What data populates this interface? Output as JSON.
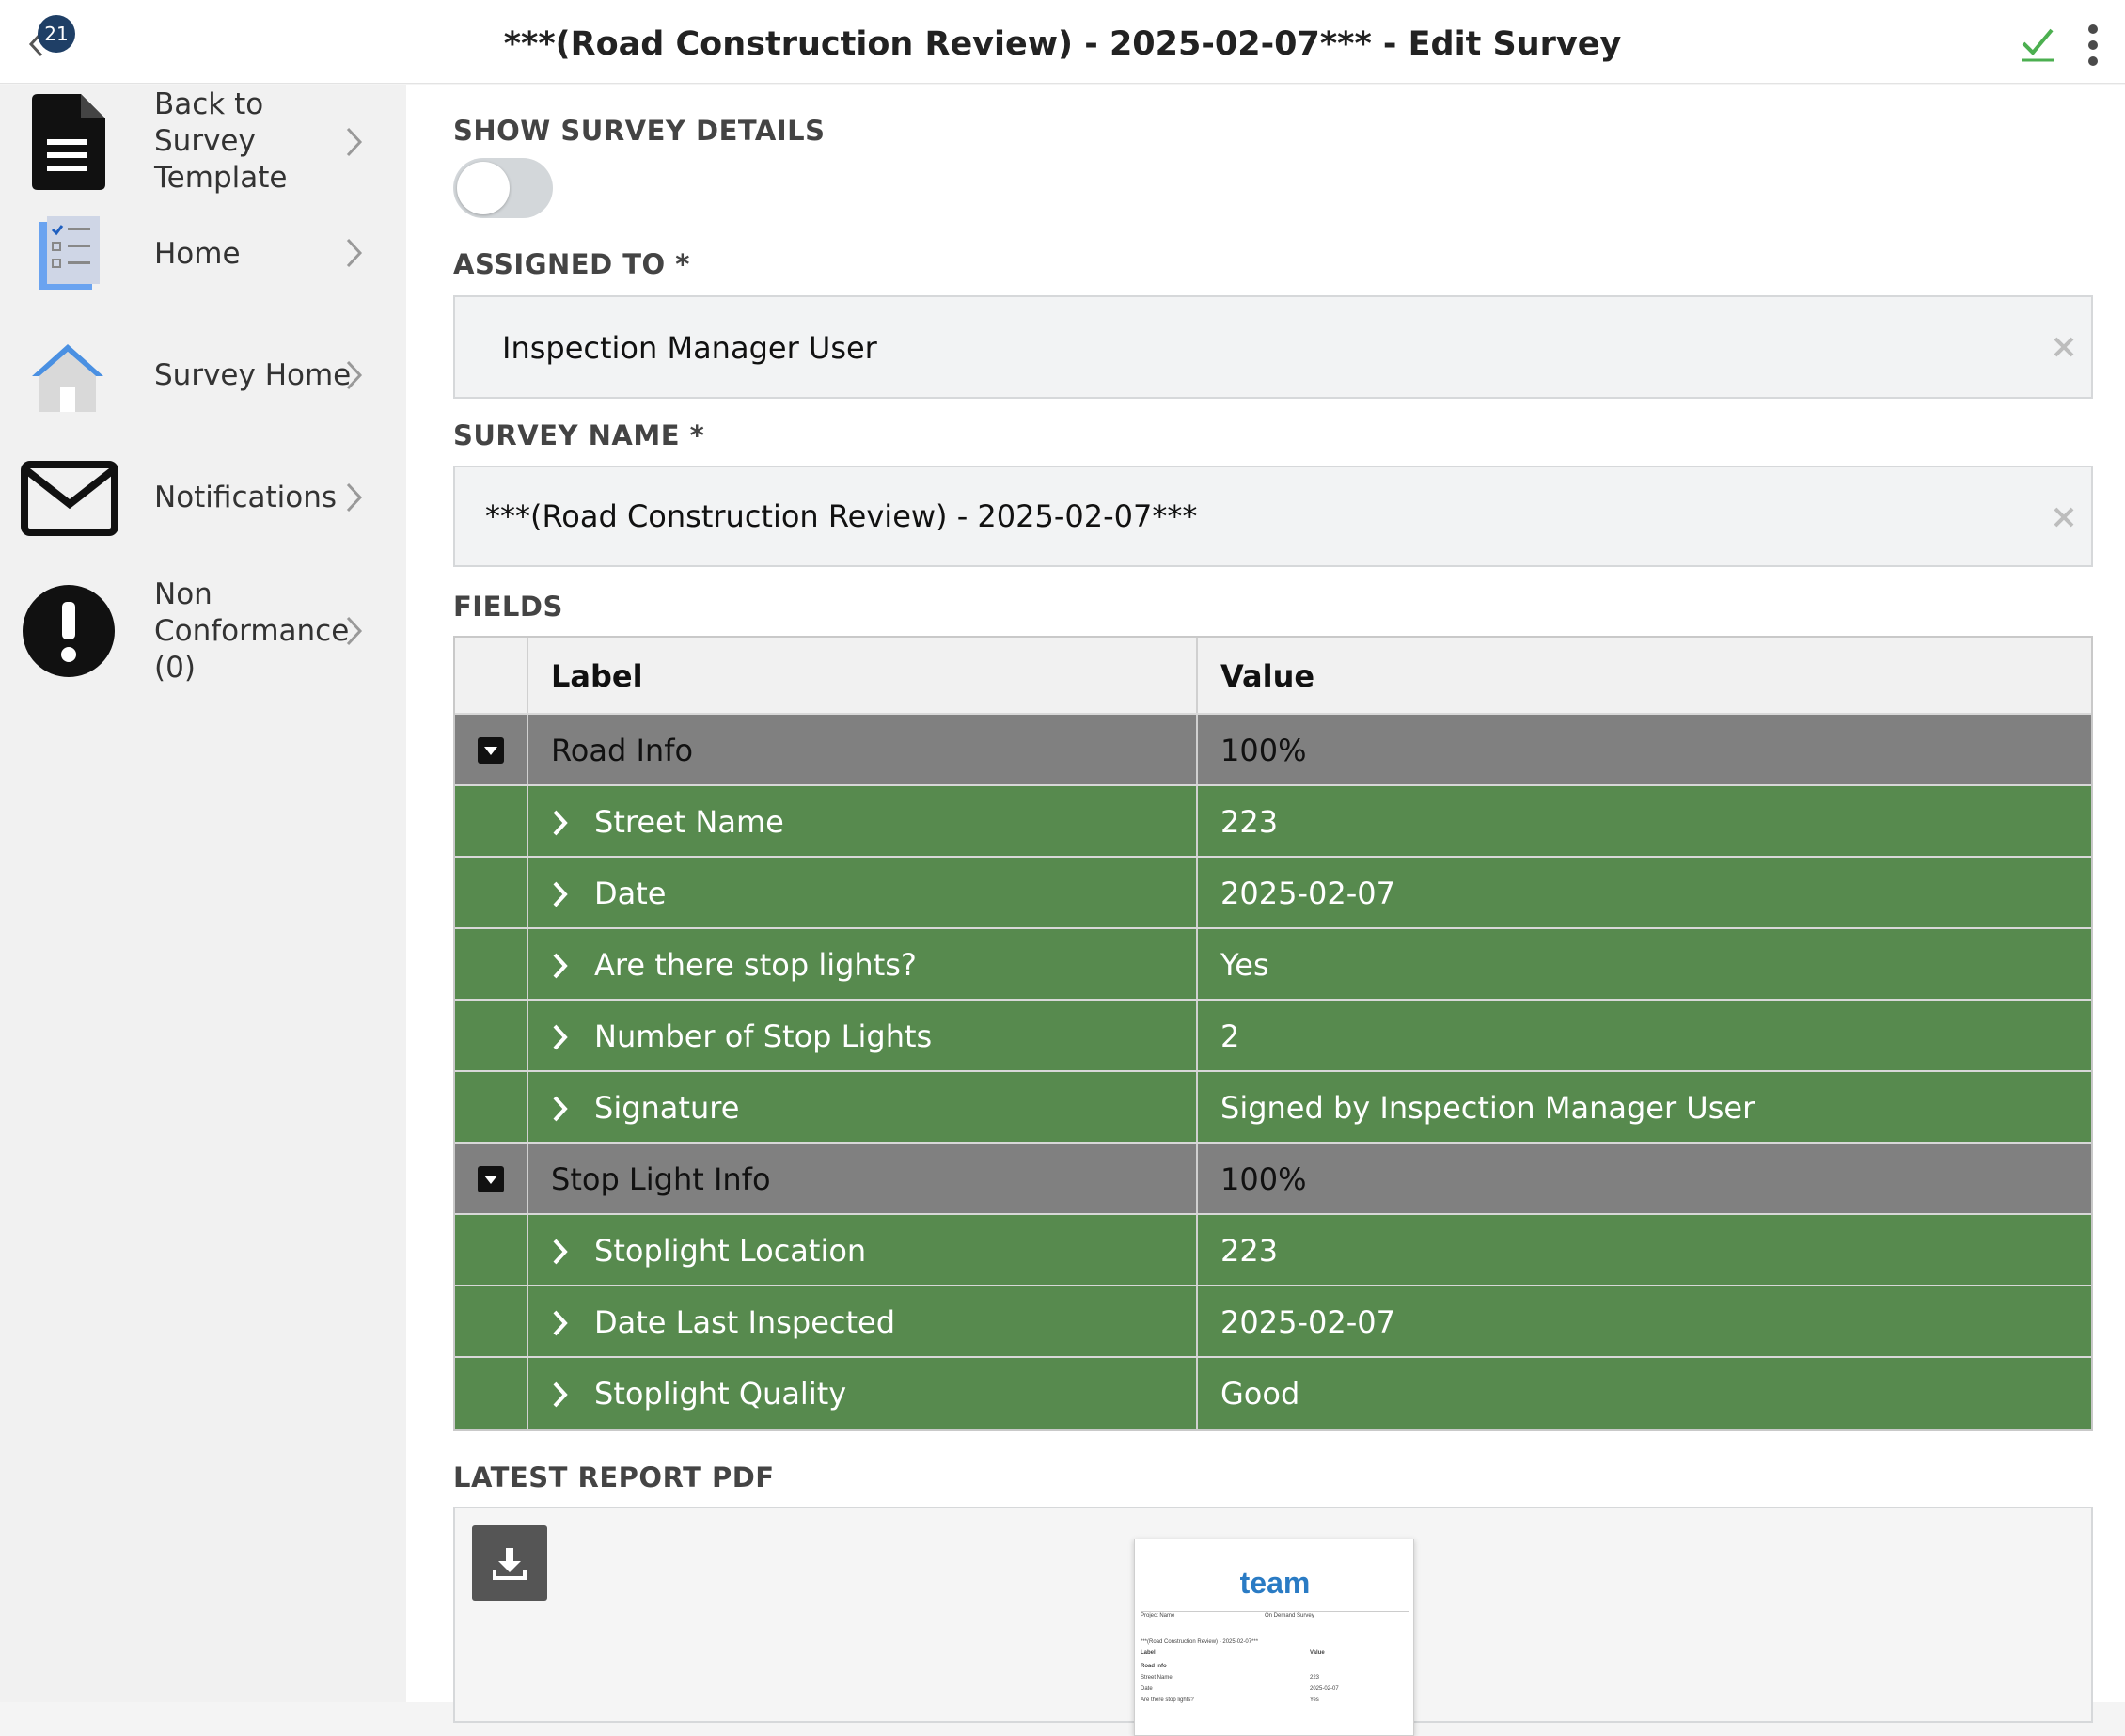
{
  "header": {
    "badge_count": "21",
    "title": "***(Road Construction Review) - 2025-02-07*** - Edit Survey",
    "accent_color": "#4caf50"
  },
  "sidebar": {
    "items": [
      {
        "label_lines": [
          "Back to",
          "Survey",
          "Template"
        ],
        "icon": "document-icon"
      },
      {
        "label_lines": [
          "Home"
        ],
        "icon": "checklist-icon"
      },
      {
        "label_lines": [
          "Survey Home"
        ],
        "icon": "house-icon"
      },
      {
        "label_lines": [
          "Notifications"
        ],
        "icon": "envelope-icon"
      },
      {
        "label_lines": [
          "Non",
          "Conformance",
          "(0)"
        ],
        "icon": "exclamation-icon"
      }
    ]
  },
  "main": {
    "show_details_label": "SHOW SURVEY DETAILS",
    "show_details_on": false,
    "assigned_label": "ASSIGNED TO *",
    "assigned_value": "Inspection Manager User",
    "survey_name_label": "SURVEY NAME *",
    "survey_name_value": "***(Road Construction Review) - 2025-02-07***",
    "fields_label": "FIELDS",
    "table": {
      "col_label": "Label",
      "col_value": "Value",
      "rows": [
        {
          "type": "group",
          "label": "Road Info",
          "value": "100%"
        },
        {
          "type": "item",
          "label": "Street Name",
          "value": "223"
        },
        {
          "type": "item",
          "label": "Date",
          "value": "2025-02-07"
        },
        {
          "type": "item",
          "label": "Are there stop lights?",
          "value": "Yes"
        },
        {
          "type": "item",
          "label": "Number of Stop Lights",
          "value": "2"
        },
        {
          "type": "item",
          "label": "Signature",
          "value": "Signed by Inspection Manager User"
        },
        {
          "type": "group",
          "label": "Stop Light Info",
          "value": "100%"
        },
        {
          "type": "item",
          "label": "Stoplight Location",
          "value": "223"
        },
        {
          "type": "item",
          "label": "Date Last Inspected",
          "value": "2025-02-07"
        },
        {
          "type": "item",
          "label": "Stoplight Quality",
          "value": "Good"
        }
      ]
    },
    "pdf_label": "LATEST REPORT PDF",
    "pdf_thumb": {
      "logo": "team",
      "lines": [
        "Project Name",
        "On Demand Survey",
        "***(Road Construction Review) - 2025-02-07***",
        "Label",
        "Value",
        "Road Info",
        "Street Name",
        "223",
        "Date",
        "2025-02-07",
        "Are there stop lights?",
        "Yes"
      ]
    }
  },
  "colors": {
    "group_row": "#808080",
    "item_row": "#578a4e",
    "header_badge": "#1f3f66"
  }
}
